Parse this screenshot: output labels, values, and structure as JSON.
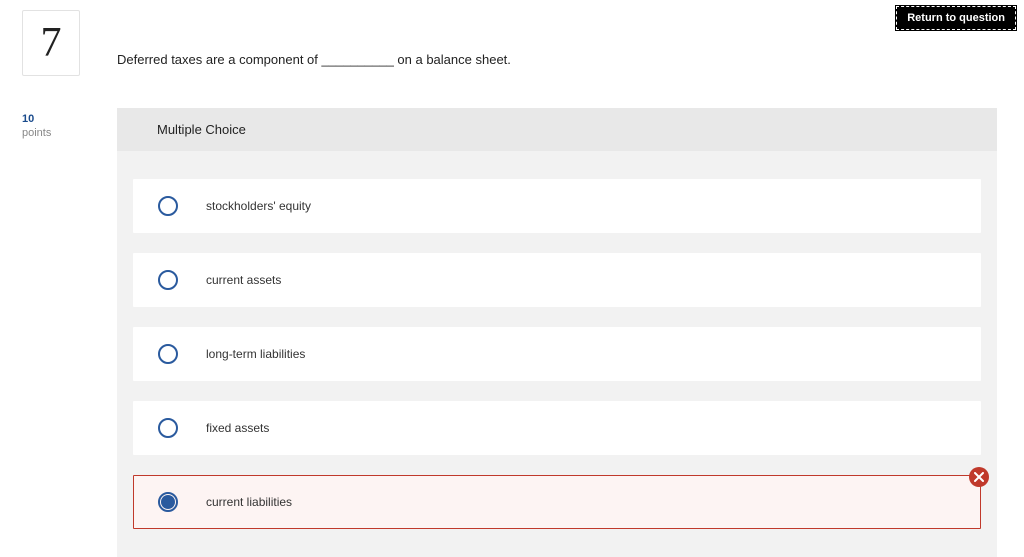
{
  "return_button": "Return to question",
  "question_number": "7",
  "points": {
    "value": "10",
    "label": "points"
  },
  "question_text": "Deferred taxes are a component of __________ on a balance sheet.",
  "section_title": "Multiple Choice",
  "options": [
    {
      "label": "stockholders' equity",
      "selected": false,
      "incorrect": false
    },
    {
      "label": "current assets",
      "selected": false,
      "incorrect": false
    },
    {
      "label": "long-term liabilities",
      "selected": false,
      "incorrect": false
    },
    {
      "label": "fixed assets",
      "selected": false,
      "incorrect": false
    },
    {
      "label": "current liabilities",
      "selected": true,
      "incorrect": true
    }
  ]
}
